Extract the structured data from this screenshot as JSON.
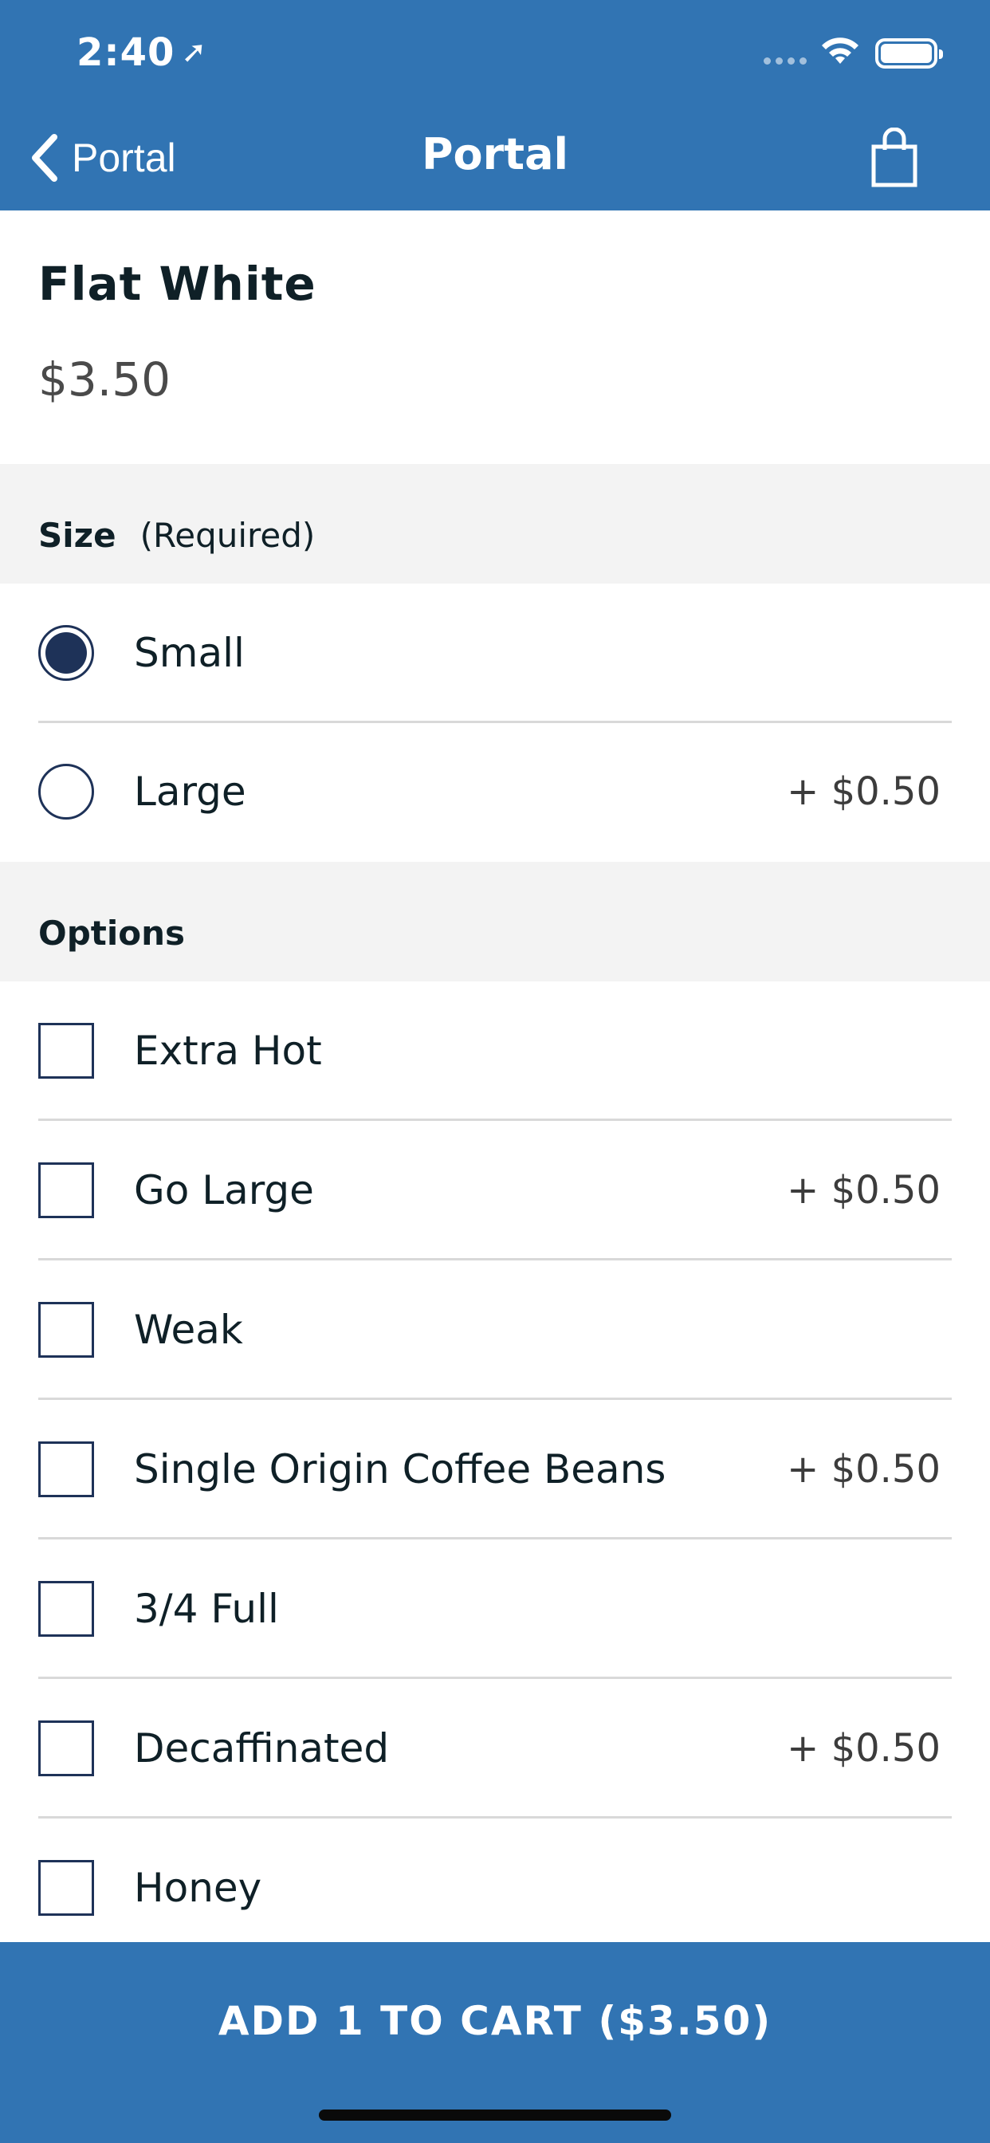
{
  "status_bar": {
    "time": "2:40",
    "location_icon": "location-arrow-icon"
  },
  "nav": {
    "back_label": "Portal",
    "title": "Portal",
    "cart_icon": "shopping-bag-icon"
  },
  "product": {
    "name": "Flat White",
    "price": "$3.50"
  },
  "size_section": {
    "title": "Size",
    "note": "(Required)",
    "options": [
      {
        "label": "Small",
        "price": "",
        "selected": true
      },
      {
        "label": "Large",
        "price": "+ $0.50",
        "selected": false
      }
    ]
  },
  "options_section": {
    "title": "Options",
    "items": [
      {
        "label": "Extra Hot",
        "price": "",
        "checked": false
      },
      {
        "label": "Go Large",
        "price": "+ $0.50",
        "checked": false
      },
      {
        "label": "Weak",
        "price": "",
        "checked": false
      },
      {
        "label": "Single Origin Coffee Beans",
        "price": "+ $0.50",
        "checked": false
      },
      {
        "label": "3/4 Full",
        "price": "",
        "checked": false
      },
      {
        "label": "Decaffinated",
        "price": "+ $0.50",
        "checked": false
      },
      {
        "label": "Honey",
        "price": "",
        "checked": false
      }
    ]
  },
  "cart_button": {
    "label": "ADD 1 TO CART ($3.50)"
  },
  "colors": {
    "primary": "#3174b3",
    "control": "#1e3258",
    "section_bg": "#f3f3f3"
  }
}
